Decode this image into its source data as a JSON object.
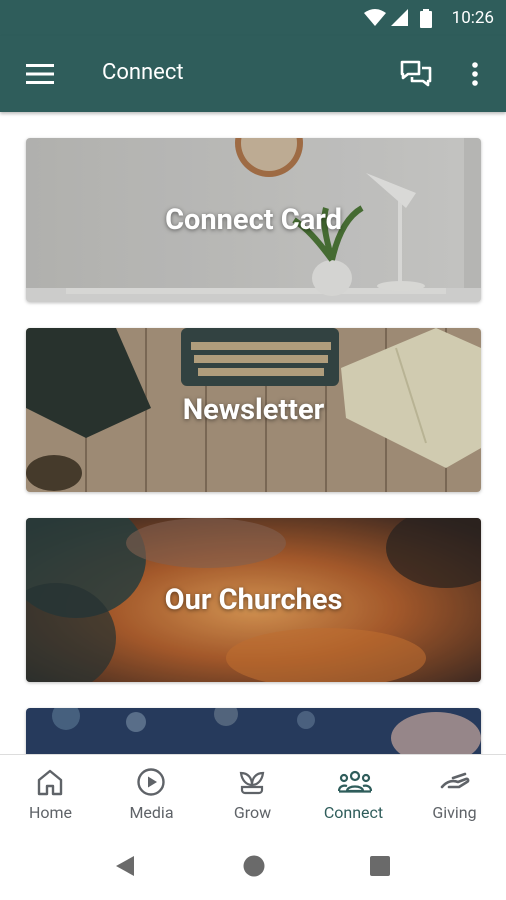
{
  "status_bar": {
    "time": "10:26"
  },
  "app_bar": {
    "title": "Connect",
    "icons": [
      "menu-icon",
      "chat-icon",
      "more-vert-icon"
    ]
  },
  "cards": [
    {
      "label": "Connect Card"
    },
    {
      "label": "Newsletter"
    },
    {
      "label": "Our Churches"
    },
    {
      "label": ""
    }
  ],
  "bottom_nav": {
    "items": [
      {
        "label": "Home",
        "icon": "home-icon",
        "active": false
      },
      {
        "label": "Media",
        "icon": "play-circle-icon",
        "active": false
      },
      {
        "label": "Grow",
        "icon": "sprout-icon",
        "active": false
      },
      {
        "label": "Connect",
        "icon": "people-icon",
        "active": true
      },
      {
        "label": "Giving",
        "icon": "hand-icon",
        "active": false
      }
    ]
  },
  "colors": {
    "primary": "#2f5d5b",
    "inactive": "#5f6368"
  }
}
